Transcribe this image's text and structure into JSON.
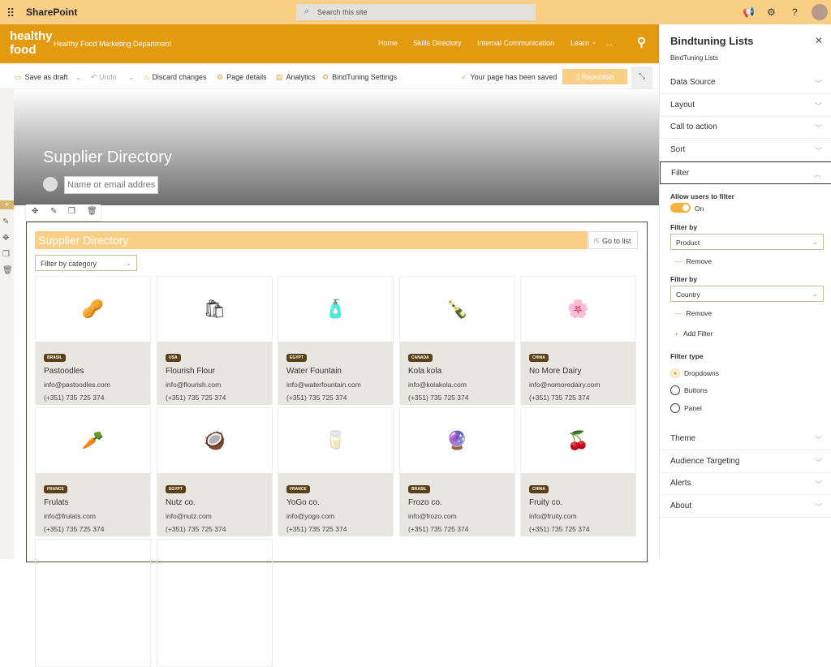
{
  "suite": {
    "app": "SharePoint",
    "search_placeholder": "Search this site"
  },
  "header": {
    "logo": "healthy food",
    "site_title": "Healthy Food Marketing Department",
    "nav": [
      "Home",
      "Skills Directory",
      "Internal Communication",
      "Learn",
      "..."
    ]
  },
  "toolbar": {
    "save_draft": "Save as draft",
    "undo": "Undo",
    "discard": "Discard changes",
    "page_details": "Page details",
    "analytics": "Analytics",
    "bindtuning_settings": "BindTuning Settings",
    "status": "Your page has been saved",
    "republish": "Republish"
  },
  "hero": {
    "title": "Supplier Directory",
    "name_placeholder": "Name or email address"
  },
  "webpart": {
    "title": "Supplier Directory",
    "go_to_list": "Go to list",
    "filter_placeholder": "Filter by category",
    "cards": [
      {
        "country": "BRASIL",
        "name": "Pastoodles",
        "email": "info@pastoodles.com",
        "phone": "(+351) 735 725 374",
        "icon": "🥜"
      },
      {
        "country": "USA",
        "name": "Flourish Flour",
        "email": "info@flourish.com",
        "phone": "(+351) 735 725 374",
        "icon": "🛍"
      },
      {
        "country": "EGYPT",
        "name": "Water Fountain",
        "email": "info@waterfountain.com",
        "phone": "(+351) 735 725 374",
        "icon": "🧴"
      },
      {
        "country": "CANADA",
        "name": "Kola kola",
        "email": "info@kolakola.com",
        "phone": "(+351) 735 725 374",
        "icon": "🍾"
      },
      {
        "country": "CHINA",
        "name": "No More Dairy",
        "email": "info@nomoredairy.com",
        "phone": "(+351) 735 725 374",
        "icon": "🌸"
      },
      {
        "country": "FRANCE",
        "name": "Frulats",
        "email": "info@frulats.com",
        "phone": "(+351) 735 725 374",
        "icon": "🥕"
      },
      {
        "country": "EGYPT",
        "name": "Nutz co.",
        "email": "info@nutz.com",
        "phone": "(+351) 735 725 374",
        "icon": "🥥"
      },
      {
        "country": "FRANCE",
        "name": "YoGo co.",
        "email": "info@yogo.com",
        "phone": "(+351) 735 725 374",
        "icon": "🥛"
      },
      {
        "country": "BRASIL",
        "name": "Frozo co.",
        "email": "info@frozo.com",
        "phone": "(+351) 735 725 374",
        "icon": "🔮"
      },
      {
        "country": "CHINA",
        "name": "Fruity co.",
        "email": "info@fruity.com",
        "phone": "(+351) 735 725 374",
        "icon": "🍒"
      }
    ]
  },
  "panel": {
    "title": "Bindtuning Lists",
    "subtitle": "BindTuning Lists",
    "sections_top": [
      "Data Source",
      "Layout",
      "Call to action",
      "Sort"
    ],
    "filter": {
      "label": "Filter",
      "allow_label": "Allow users to filter",
      "toggle_state": "On",
      "toggle_on": true,
      "filter_by_label": "Filter by",
      "filters": [
        "Product",
        "Country"
      ],
      "remove": "Remove",
      "add_filter": "Add Filter",
      "type_label": "Filter type",
      "types": [
        "Dropdowns",
        "Buttons",
        "Panel"
      ],
      "selected_type": "Dropdowns"
    },
    "sections_bottom": [
      "Theme",
      "Audience Targeting",
      "Alerts",
      "About"
    ]
  },
  "colors": {
    "accent": "#e39a0e",
    "light_accent": "#f9cf86",
    "badge": "#5a4017"
  }
}
